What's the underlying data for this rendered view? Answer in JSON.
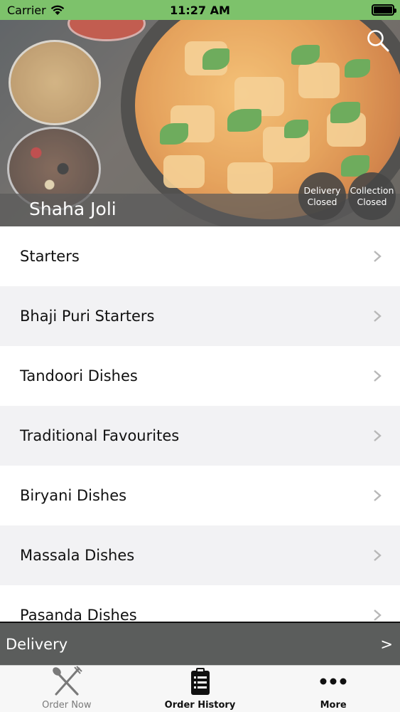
{
  "status_bar": {
    "carrier": "Carrier",
    "time": "11:27 AM"
  },
  "hero": {
    "restaurant_name": "Shaha Joli",
    "delivery_status": {
      "line1": "Delivery",
      "line2": "Closed"
    },
    "collection_status": {
      "line1": "Collection",
      "line2": "Closed"
    },
    "search_icon": "search-icon"
  },
  "menu": {
    "items": [
      {
        "label": "Starters"
      },
      {
        "label": "Bhaji Puri Starters"
      },
      {
        "label": "Tandoori Dishes"
      },
      {
        "label": "Traditional Favourites"
      },
      {
        "label": "Biryani Dishes"
      },
      {
        "label": "Massala Dishes"
      },
      {
        "label": "Pasanda Dishes"
      }
    ]
  },
  "delivery_bar": {
    "label": "Delivery",
    "arrow": ">"
  },
  "tab_bar": {
    "tabs": [
      {
        "label": "Order Now",
        "icon": "fork-knife-icon",
        "active": false
      },
      {
        "label": "Order History",
        "icon": "clipboard-list-icon",
        "active": true
      },
      {
        "label": "More",
        "icon": "more-dots-icon",
        "active": true
      }
    ]
  },
  "colors": {
    "status_bar": "#7dc26b",
    "delivery_bar": "#5b5d5c",
    "row_alt": "#f2f2f4",
    "chevron": "#b8b8b8"
  }
}
